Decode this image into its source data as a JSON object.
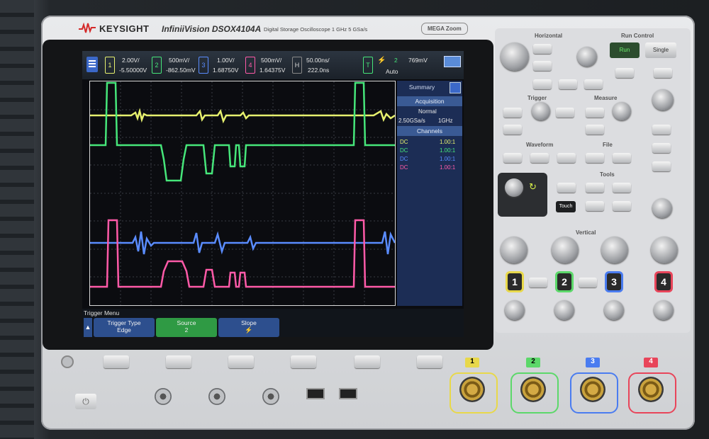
{
  "brand": {
    "name": "KEYSIGHT",
    "model": "InfiniiVision DSOX4104A",
    "description": "Digital Storage Oscilloscope   1 GHz   5 GSa/s",
    "megazoom": "MEGA Zoom"
  },
  "channels": [
    {
      "num": "1",
      "scale": "2.00V/",
      "offset": "-5.50000V",
      "color": "#e6f06e"
    },
    {
      "num": "2",
      "scale": "500mV/",
      "offset": "-862.50mV",
      "color": "#46e67a"
    },
    {
      "num": "3",
      "scale": "1.00V/",
      "offset": "1.68750V",
      "color": "#5a8cff"
    },
    {
      "num": "4",
      "scale": "500mV/",
      "offset": "1.64375V",
      "color": "#ff5aa8"
    }
  ],
  "timebase": {
    "label": "H",
    "scale": "50.00ns/",
    "delay": "222.0ns"
  },
  "trigger": {
    "label": "T",
    "source": "2",
    "level": "769mV",
    "mode": "Auto"
  },
  "summary": {
    "title": "Summary",
    "acquisition_head": "Acquisition",
    "acq_mode": "Normal",
    "sample_rate": "2.50GSa/s",
    "bandwidth": "1GHz",
    "channels_head": "Channels",
    "rows": [
      {
        "coupling": "DC",
        "probe": "1.00:1",
        "color": "#e6f06e"
      },
      {
        "coupling": "DC",
        "probe": "1.00:1",
        "color": "#46e67a"
      },
      {
        "coupling": "DC",
        "probe": "1.00:1",
        "color": "#5a8cff"
      },
      {
        "coupling": "DC",
        "probe": "1.00:1",
        "color": "#ff5aa8"
      }
    ]
  },
  "softkeys": {
    "menu_title": "Trigger Menu",
    "keys": [
      {
        "title": "Trigger Type",
        "value": "Edge"
      },
      {
        "title": "Source",
        "value": "2"
      },
      {
        "title": "Slope",
        "value": "rising-edge-icon"
      }
    ]
  },
  "panel": {
    "horizontal": "Horizontal",
    "run_control": "Run Control",
    "run": "Run",
    "single": "Single",
    "trigger": "Trigger",
    "measure": "Measure",
    "waveform": "Waveform",
    "file": "File",
    "tools": "Tools",
    "touch": "Touch",
    "vertical": "Vertical"
  },
  "inputs": [
    {
      "num": "1",
      "color": "#e8d84a"
    },
    {
      "num": "2",
      "color": "#5cd86a"
    },
    {
      "num": "3",
      "color": "#4a7cf0"
    },
    {
      "num": "4",
      "color": "#e8455a"
    }
  ]
}
